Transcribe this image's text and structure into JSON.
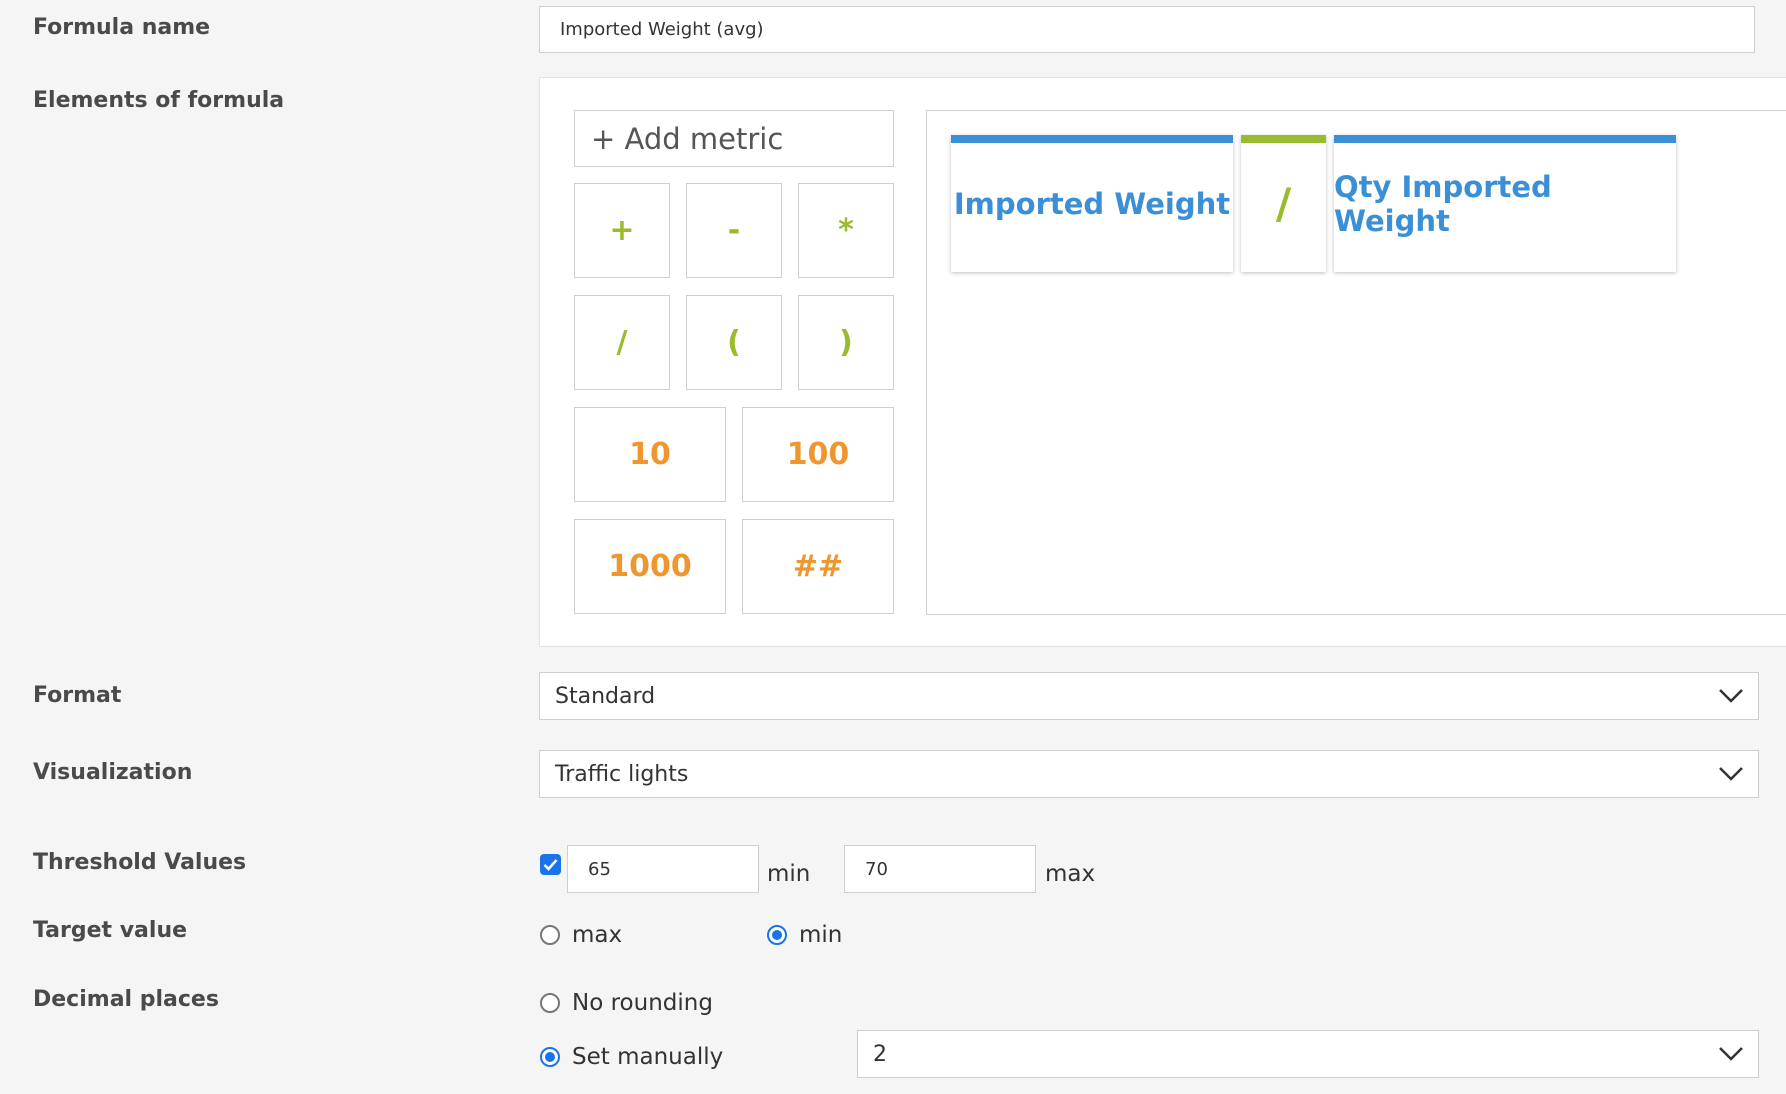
{
  "labels": {
    "formula_name": "Formula name",
    "elements": "Elements of formula",
    "format": "Format",
    "visualization": "Visualization",
    "threshold": "Threshold Values",
    "target": "Target value",
    "decimals": "Decimal places"
  },
  "formula_name_value": "Imported Weight (avg)",
  "add_metric": "+ Add metric",
  "operators": [
    "+",
    "-",
    "*",
    "/",
    "(",
    ")"
  ],
  "constants": [
    "10",
    "100",
    "1000",
    "##"
  ],
  "formula_tokens": [
    "Imported Weight",
    "/",
    "Qty Imported Weight"
  ],
  "format_value": "Standard",
  "visualization_value": "Traffic lights",
  "threshold": {
    "min_value": "65",
    "min_label": "min",
    "max_value": "70",
    "max_label": "max"
  },
  "target": {
    "max_label": "max",
    "min_label": "min",
    "selected": "min"
  },
  "decimals": {
    "no_rounding": "No rounding",
    "set_manually": "Set manually",
    "value": "2"
  },
  "colors": {
    "metric": "#3b8fd6",
    "operator": "#9bbb2e",
    "constant": "#f0962f",
    "accent": "#1a73e8"
  }
}
